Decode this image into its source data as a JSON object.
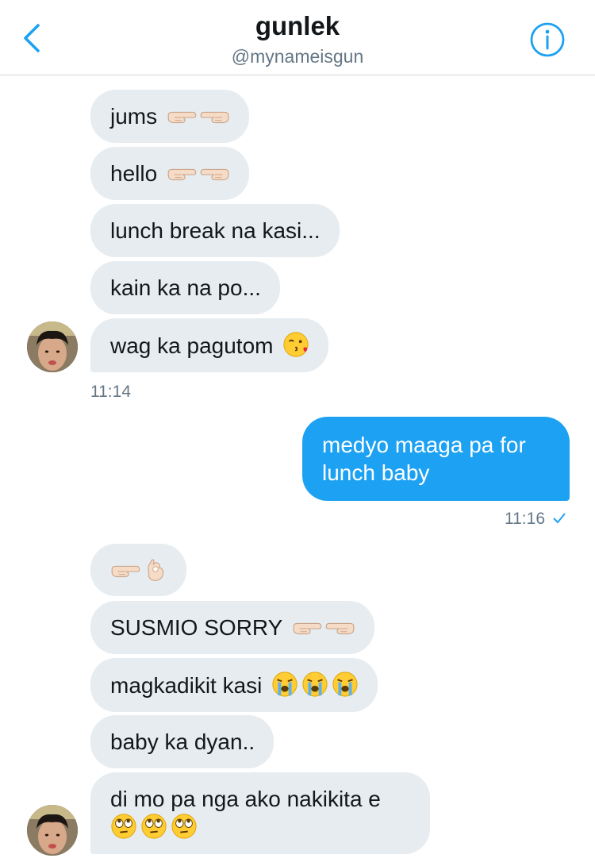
{
  "header": {
    "name": "gunlek",
    "handle": "@mynameisgun"
  },
  "messages_group1": [
    {
      "text": "jums",
      "emojis": [
        "point-right",
        "point-left"
      ]
    },
    {
      "text": "hello",
      "emojis": [
        "point-right",
        "point-left"
      ]
    },
    {
      "text": "lunch break na kasi..."
    },
    {
      "text": "kain ka na po..."
    },
    {
      "text": "wag ka pagutom",
      "emojis": [
        "kiss-face"
      ]
    }
  ],
  "time_group1": "11:14",
  "sent_message": {
    "line1": "medyo maaga pa for",
    "line2": "lunch baby"
  },
  "time_sent": "11:16",
  "messages_group2": [
    {
      "text": "",
      "emojis": [
        "point-right",
        "ok-hand"
      ]
    },
    {
      "text": "SUSMIO SORRY",
      "emojis": [
        "point-right",
        "point-left"
      ]
    },
    {
      "text": "magkadikit kasi",
      "emojis": [
        "crying-face",
        "crying-face",
        "crying-face"
      ]
    },
    {
      "text": "baby ka dyan.."
    },
    {
      "text": "di mo pa nga ako nakikita e",
      "emojis": [
        "eye-roll-face",
        "eye-roll-face",
        "eye-roll-face"
      ]
    }
  ],
  "colors": {
    "accent": "#1da1f2",
    "bubble_in": "#e6ecf0",
    "muted": "#657786"
  }
}
